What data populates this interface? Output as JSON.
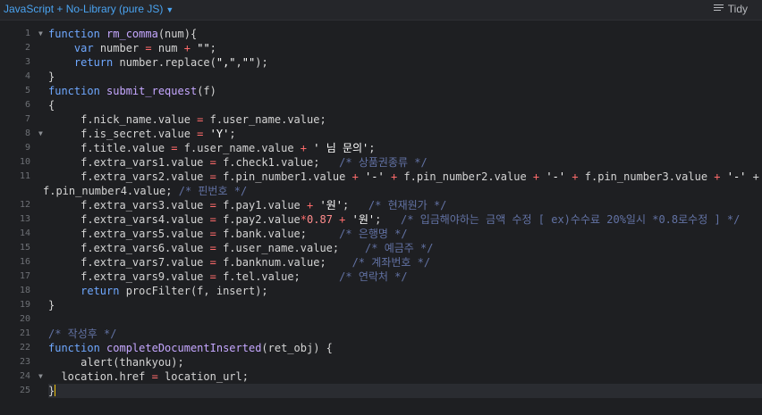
{
  "toolbar": {
    "language": "JavaScript + No-Library (pure JS)",
    "tidy": "Tidy"
  },
  "lines": [
    "function rm_comma(num){",
    "    var number = num + \"\";",
    "    return number.replace(\",\",\"\");",
    "}",
    "function submit_request(f)",
    "{",
    "     f.nick_name.value = f.user_name.value;",
    "     f.is_secret.value = 'Y';",
    "     f.title.value = f.user_name.value + ' 님 문의';",
    "     f.extra_vars1.value = f.check1.value;   /* 상품권종류 */",
    "     f.extra_vars2.value = f.pin_number1.value + '-' + f.pin_number2.value + '-' + f.pin_number3.value + '-' +",
    "f.pin_number4.value; /* 핀번호 */",
    "     f.extra_vars3.value = f.pay1.value + '원';   /* 현재원가 */",
    "     f.extra_vars4.value = f.pay2.value*0.87 + '원';   /* 입금해야하는 금액 수정 [ ex)수수료 20%일시 *0.8로수정 ] */",
    "     f.extra_vars5.value = f.bank.value;     /* 은행명 */",
    "     f.extra_vars6.value = f.user_name.value;    /* 예금주 */",
    "     f.extra_vars7.value = f.banknum.value;    /* 계좌번호 */",
    "     f.extra_vars9.value = f.tel.value;      /* 연락처 */",
    "     return procFilter(f, insert);",
    "}",
    "",
    "/* 작성후 */",
    "function completeDocumentInserted(ret_obj) {",
    "     alert(thankyou);",
    "  location.href = location_url;",
    "}"
  ],
  "line_numbers": [
    "1",
    "2",
    "3",
    "4",
    "5",
    "6",
    "7",
    "8",
    "9",
    "10",
    "11",
    "",
    "12",
    "13",
    "14",
    "15",
    "16",
    "17",
    "18",
    "19",
    "20",
    "21",
    "22",
    "23",
    "24",
    "25"
  ]
}
